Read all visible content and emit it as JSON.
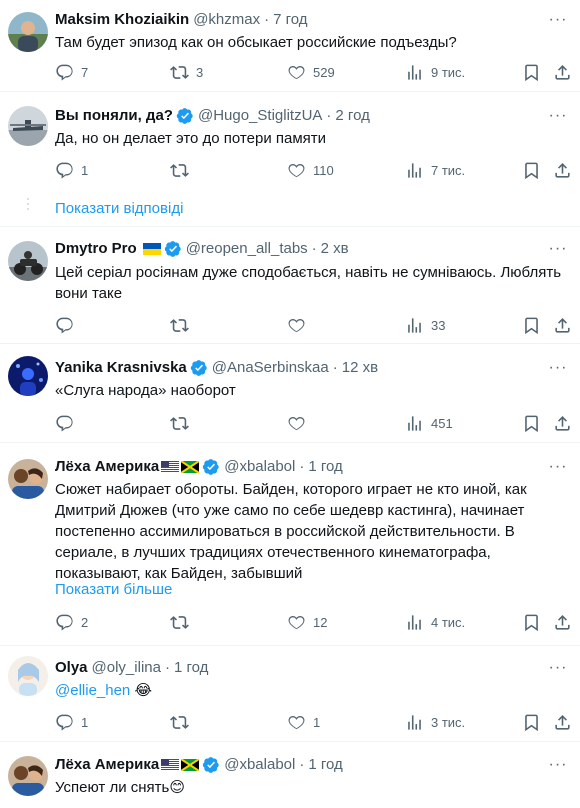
{
  "tweets": [
    {
      "name": "Maksim Khoziaikin",
      "handle": "@khzmax",
      "time": "7 год",
      "verified": false,
      "text": "Там будет эпизод как он обсыкает российские подъезды?",
      "replies": "7",
      "retweets": "3",
      "likes": "529",
      "views": "9 тис."
    },
    {
      "name": "Вы поняли, да?",
      "handle": "@Hugo_StiglitzUA",
      "time": "2 год",
      "verified": true,
      "text": "Да, но он делает это до потери памяти",
      "replies": "1",
      "retweets": "",
      "likes": "110",
      "views": "7 тис."
    },
    {
      "name": "Dmytro Pro",
      "handle": "@reopen_all_tabs",
      "time": "2 хв",
      "verified": true,
      "text_line1": "Цей серіал росіянам дуже сподобається, навіть не сумніваюсь. Люблять",
      "text_line2": "вони таке",
      "replies": "",
      "retweets": "",
      "likes": "",
      "views": "33"
    },
    {
      "name": "Yanika Krasnivska",
      "handle": "@AnaSerbinskaa",
      "time": "12 хв",
      "verified": true,
      "text": "«Слуга народа» наоборот",
      "replies": "",
      "retweets": "",
      "likes": "",
      "views": "451"
    },
    {
      "name": "Лёха Америка",
      "handle": "@xbalabol",
      "time": "1 год",
      "verified": true,
      "text_lines": [
        "Сюжет набирает обороты. Байден, которого играет не кто иной, как",
        "Дмитрий Дюжев (что уже само по себе шедевр кастинга), начинает",
        "постепенно ассимилироваться в российской действительности. В",
        "сериале, в лучших традициях отечественного кинематографа,",
        "показывают, как Байден, забывший"
      ],
      "show_more": "Показати більше",
      "replies": "2",
      "retweets": "",
      "likes": "12",
      "views": "4 тис."
    },
    {
      "name": "Olya",
      "handle": "@oly_ilina",
      "time": "1 год",
      "verified": false,
      "mention": "@ellie_hen",
      "emoji": "😂",
      "replies": "1",
      "retweets": "",
      "likes": "1",
      "views": "3 тис."
    },
    {
      "name": "Лёха Америка",
      "handle": "@xbalabol",
      "time": "1 год",
      "verified": true,
      "text": "Успеют ли снять",
      "emoji": "😊"
    }
  ],
  "show_replies": "Показати відповіді",
  "dot": "·",
  "more_glyph": "···",
  "colors": {
    "accent": "#1d9bf0",
    "secondary_text": "#536471",
    "border": "#eff3f4"
  }
}
